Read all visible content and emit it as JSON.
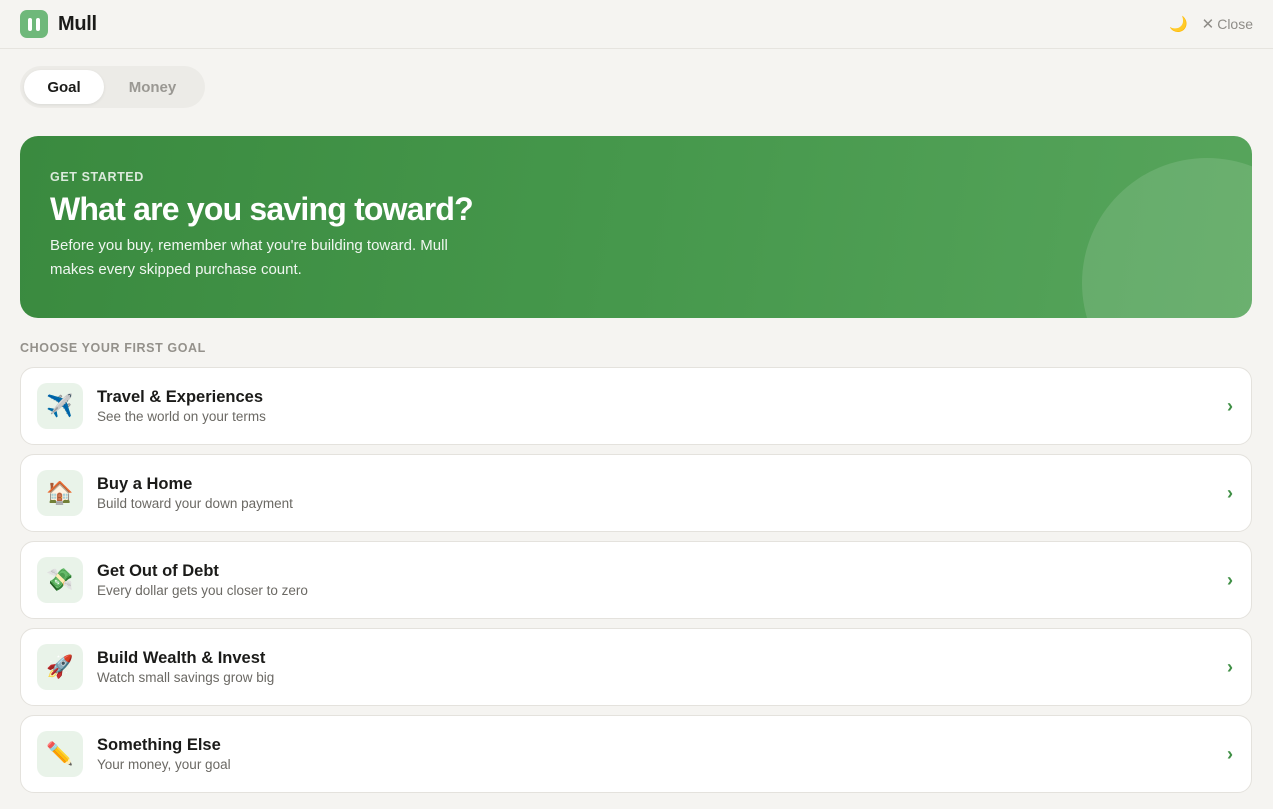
{
  "header": {
    "app_name": "Mull",
    "theme_icon": "moon-icon",
    "close_symbol": "✕",
    "close_label": "Close"
  },
  "tabs": [
    {
      "label": "Goal",
      "active": true
    },
    {
      "label": "Money",
      "active": false
    }
  ],
  "hero": {
    "eyebrow": "GET STARTED",
    "title": "What are you saving toward?",
    "subtitle": "Before you buy, remember what you're building toward. Mull makes every skipped purchase count."
  },
  "section_label": "CHOOSE YOUR FIRST GOAL",
  "goals": [
    {
      "icon": "airplane-icon",
      "glyph": "✈️",
      "title": "Travel & Experiences",
      "description": "See the world on your terms"
    },
    {
      "icon": "house-icon",
      "glyph": "🏠",
      "title": "Buy a Home",
      "description": "Build toward your down payment"
    },
    {
      "icon": "money-icon",
      "glyph": "💸",
      "title": "Get Out of Debt",
      "description": "Every dollar gets you closer to zero"
    },
    {
      "icon": "rocket-icon",
      "glyph": "🚀",
      "title": "Build Wealth & Invest",
      "description": "Watch small savings grow big"
    },
    {
      "icon": "pencil-icon",
      "glyph": "✏️",
      "title": "Something Else",
      "description": "Your money, your goal"
    }
  ],
  "chevron_glyph": "›",
  "colors": {
    "brand_green": "#3a8a3f",
    "accent_green": "#6fb87a"
  }
}
